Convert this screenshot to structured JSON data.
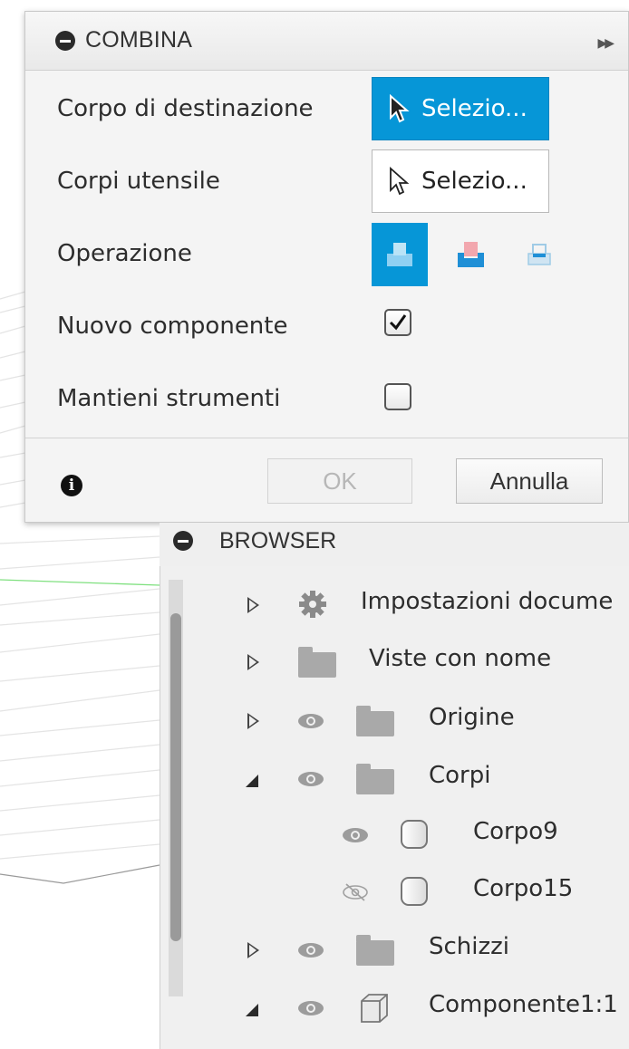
{
  "combina": {
    "title": "COMBINA",
    "rows": {
      "target_label": "Corpo di destinazione",
      "target_button": "Selezio...",
      "tools_label": "Corpi utensile",
      "tools_button": "Selezio...",
      "operation_label": "Operazione",
      "new_component_label": "Nuovo componente",
      "new_component_checked": true,
      "keep_tools_label": "Mantieni strumenti",
      "keep_tools_checked": false
    },
    "operation_options": [
      "join-icon",
      "cut-icon",
      "intersect-icon"
    ],
    "operation_selected": "join-icon",
    "ok_label": "OK",
    "cancel_label": "Annulla"
  },
  "browser": {
    "title": "BROWSER",
    "items": [
      {
        "label": "Impostazioni docume",
        "icon": "gear-icon",
        "expanded": false
      },
      {
        "label": "Viste con nome",
        "icon": "folder-icon",
        "expanded": false
      },
      {
        "label": "Origine",
        "icon": "folder-icon",
        "expanded": false
      },
      {
        "label": "Corpi",
        "icon": "folder-icon",
        "expanded": true
      },
      {
        "label": "Corpo9",
        "icon": "body-icon"
      },
      {
        "label": "Corpo15",
        "icon": "body-icon",
        "hidden": true
      },
      {
        "label": "Schizzi",
        "icon": "folder-icon",
        "expanded": false
      },
      {
        "label": "Componente1:1",
        "icon": "component-icon",
        "expanded": true
      }
    ]
  },
  "colors": {
    "accent": "#0696d7",
    "cut_red": "#f2a7ae",
    "panel": "#f4f4f4"
  }
}
